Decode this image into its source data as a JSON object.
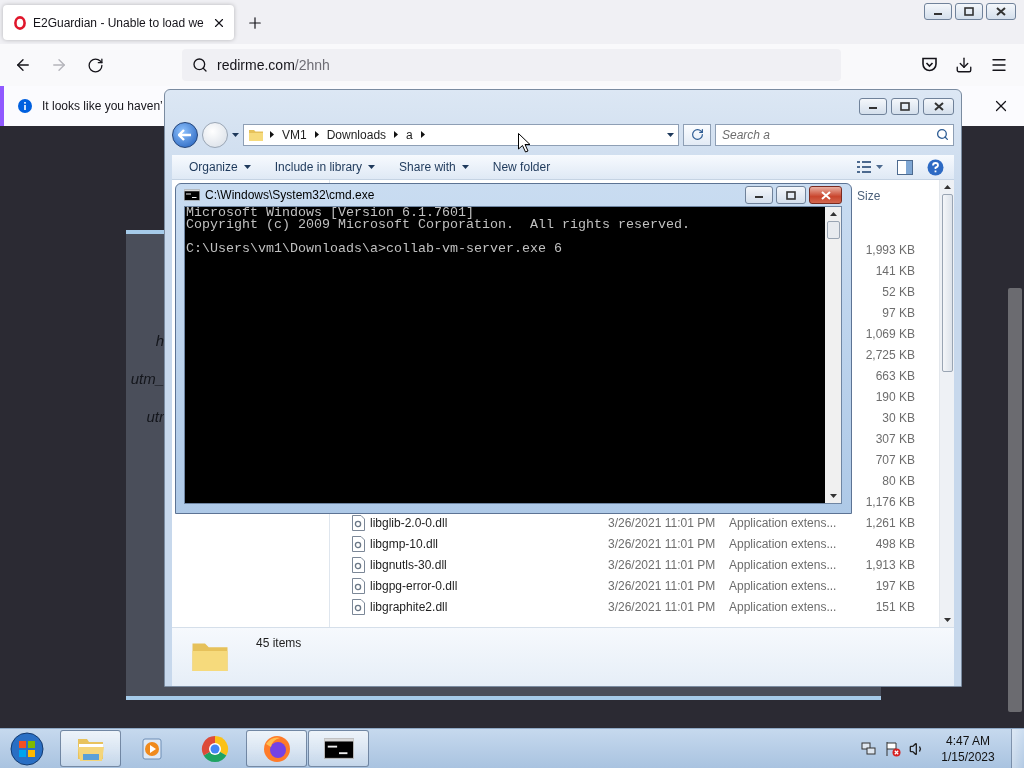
{
  "browser": {
    "tab": {
      "title": "E2Guardian - Unable to load we",
      "selected": true
    },
    "navigation": {
      "back_disabled": false,
      "forward_disabled": true
    },
    "address": {
      "host": "redirme.com",
      "path": "/2hnh"
    },
    "notification": {
      "text": "It looks like you haven’"
    },
    "page_fragments": [
      "h",
      "utm_",
      "utr"
    ]
  },
  "explorer": {
    "active": false,
    "breadcrumb": [
      "VM1",
      "Downloads",
      "a"
    ],
    "search": {
      "placeholder": "Search a"
    },
    "toolbar": [
      {
        "label": "Organize",
        "dropdown": true
      },
      {
        "label": "Include in library",
        "dropdown": true
      },
      {
        "label": "Share with",
        "dropdown": true
      },
      {
        "label": "New folder",
        "dropdown": false
      }
    ],
    "columns": [
      "Size"
    ],
    "files": [
      {
        "size": "1,993 KB"
      },
      {
        "size": "141 KB"
      },
      {
        "size": "52 KB"
      },
      {
        "size": "97 KB"
      },
      {
        "size": "1,069 KB"
      },
      {
        "size": "2,725 KB"
      },
      {
        "size": "663 KB"
      },
      {
        "size": "190 KB"
      },
      {
        "size": "30 KB"
      },
      {
        "size": "307 KB"
      },
      {
        "size": "707 KB"
      },
      {
        "size": "80 KB"
      },
      {
        "size": "1,176 KB"
      },
      {
        "name": "libglib-2.0-0.dll",
        "date": "3/26/2021 11:01 PM",
        "type": "Application extens...",
        "size": "1,261 KB"
      },
      {
        "name": "libgmp-10.dll",
        "date": "3/26/2021 11:01 PM",
        "type": "Application extens...",
        "size": "498 KB"
      },
      {
        "name": "libgnutls-30.dll",
        "date": "3/26/2021 11:01 PM",
        "type": "Application extens...",
        "size": "1,913 KB"
      },
      {
        "name": "libgpg-error-0.dll",
        "date": "3/26/2021 11:01 PM",
        "type": "Application extens...",
        "size": "197 KB"
      },
      {
        "name": "libgraphite2.dll",
        "date": "3/26/2021 11:01 PM",
        "type": "Application extens...",
        "size": "151 KB"
      }
    ],
    "status": "45 items"
  },
  "console": {
    "active": true,
    "title": "C:\\Windows\\System32\\cmd.exe",
    "blocks": [
      [
        "Microsoft Windows [Version 6.1.7601]",
        "Copyright (c) 2009 Microsoft Corporation.  All rights reserved."
      ],
      [
        "C:\\Users\\vm1\\Downloads\\a>collab-vm-server.exe 6"
      ]
    ]
  },
  "taskbar": {
    "items": [
      {
        "kind": "explorer",
        "running": true
      },
      {
        "kind": "media",
        "running": false
      },
      {
        "kind": "chrome",
        "running": false
      },
      {
        "kind": "firefox",
        "running": true
      },
      {
        "kind": "console",
        "running": true
      }
    ],
    "time": "4:47 AM",
    "date": "1/15/2023"
  }
}
